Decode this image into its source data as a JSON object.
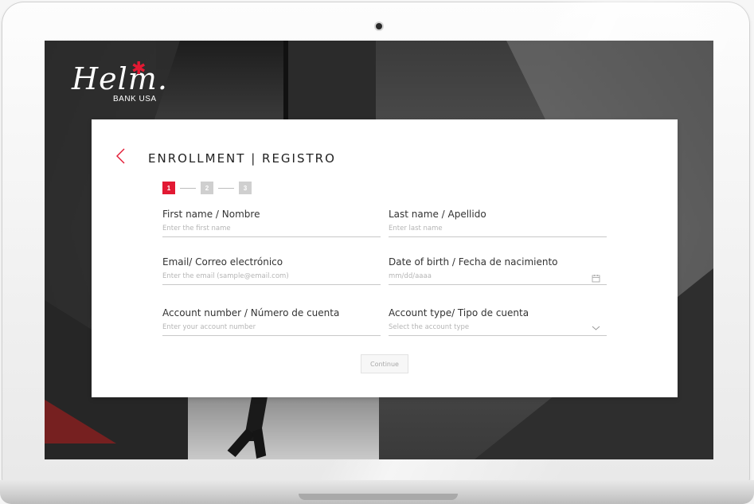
{
  "brand": {
    "logo_text": "Helm.",
    "logo_sub": "BANK USA",
    "accent_color": "#e21933"
  },
  "form": {
    "title": "ENROLLMENT | REGISTRO",
    "back_icon": "chevron-left-icon",
    "steps": [
      {
        "label": "1",
        "active": true
      },
      {
        "label": "2",
        "active": false
      },
      {
        "label": "3",
        "active": false
      }
    ],
    "fields": {
      "first_name": {
        "label": "First name / Nombre",
        "placeholder": "Enter the first name"
      },
      "last_name": {
        "label": "Last name / Apellido",
        "placeholder": "Enter last name"
      },
      "email": {
        "label": "Email/ Correo electrónico",
        "placeholder": "Enter the email (sample@email.com)"
      },
      "dob": {
        "label": "Date of birth / Fecha de nacimiento",
        "placeholder": "mm/dd/aaaa",
        "icon": "calendar-icon"
      },
      "account_number": {
        "label": "Account number / Número de cuenta",
        "placeholder": "Enter your account number"
      },
      "account_type": {
        "label": "Account type/ Tipo de cuenta",
        "placeholder": "Select the account type",
        "icon": "chevron-down-icon"
      }
    },
    "continue_label": "Continue"
  }
}
